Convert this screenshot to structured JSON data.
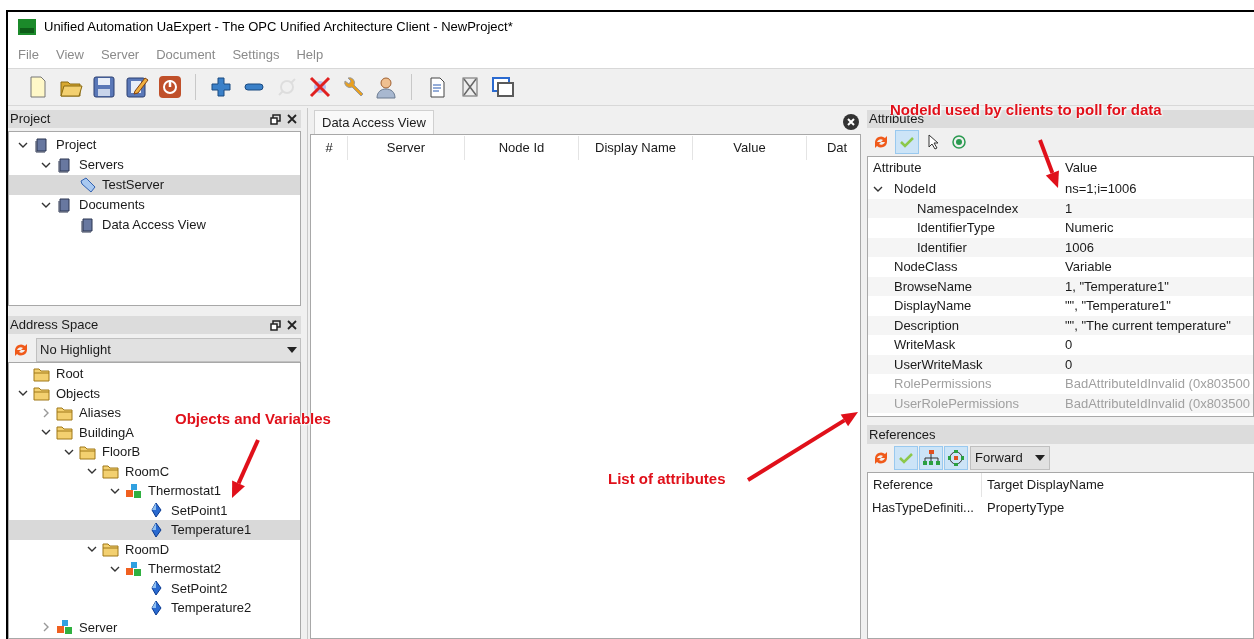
{
  "window": {
    "title": "Unified Automation UaExpert - The OPC Unified Architecture Client - NewProject*"
  },
  "menu": [
    "File",
    "View",
    "Server",
    "Document",
    "Settings",
    "Help"
  ],
  "toolbar": [
    {
      "disabled": false
    },
    {
      "disabled": false
    },
    {
      "disabled": false
    },
    {
      "disabled": false
    },
    {
      "disabled": false
    },
    {
      "disabled": false
    },
    {
      "disabled": false
    },
    {
      "disabled": true
    },
    {
      "disabled": false
    },
    {
      "disabled": false
    },
    {
      "disabled": false
    },
    {
      "disabled": false
    },
    {
      "disabled": false
    },
    {
      "disabled": false
    }
  ],
  "project_panel": {
    "title": "Project",
    "tree": [
      {
        "label": "Project",
        "kind": "book",
        "expanded": true,
        "selected": false,
        "children": [
          {
            "label": "Servers",
            "kind": "book",
            "expanded": true,
            "selected": false,
            "children": [
              {
                "label": "TestServer",
                "kind": "server",
                "selected": true
              }
            ]
          },
          {
            "label": "Documents",
            "kind": "book",
            "expanded": true,
            "selected": false,
            "children": [
              {
                "label": "Data Access View",
                "kind": "book",
                "selected": false
              }
            ]
          }
        ]
      }
    ]
  },
  "address_space_panel": {
    "title": "Address Space",
    "highlight": "No Highlight",
    "tree": [
      {
        "label": "Root",
        "kind": "folder",
        "selected": false
      },
      {
        "label": "Objects",
        "kind": "folder",
        "expanded": true,
        "selected": false,
        "children": [
          {
            "label": "Aliases",
            "kind": "folder",
            "expanded": false,
            "selected": false
          },
          {
            "label": "BuildingA",
            "kind": "folder",
            "expanded": true,
            "selected": false,
            "children": [
              {
                "label": "FloorB",
                "kind": "folder",
                "expanded": true,
                "selected": false,
                "children": [
                  {
                    "label": "RoomC",
                    "kind": "folder",
                    "expanded": true,
                    "selected": false,
                    "children": [
                      {
                        "label": "Thermostat1",
                        "kind": "object",
                        "expanded": true,
                        "selected": false,
                        "children": [
                          {
                            "label": "SetPoint1",
                            "kind": "variable",
                            "selected": false
                          },
                          {
                            "label": "Temperature1",
                            "kind": "variable",
                            "selected": true
                          }
                        ]
                      }
                    ]
                  },
                  {
                    "label": "RoomD",
                    "kind": "folder",
                    "expanded": true,
                    "selected": false,
                    "children": [
                      {
                        "label": "Thermostat2",
                        "kind": "object",
                        "expanded": true,
                        "selected": false,
                        "children": [
                          {
                            "label": "SetPoint2",
                            "kind": "variable",
                            "selected": false
                          },
                          {
                            "label": "Temperature2",
                            "kind": "variable",
                            "selected": false
                          }
                        ]
                      }
                    ]
                  }
                ]
              }
            ]
          },
          {
            "label": "Server",
            "kind": "object",
            "expanded": false,
            "selected": false
          }
        ]
      }
    ]
  },
  "document": {
    "tab": "Data Access View",
    "columns": [
      "#",
      "Server",
      "Node Id",
      "Display Name",
      "Value",
      "Dat"
    ]
  },
  "attributes_panel": {
    "title": "Attributes",
    "toolbar": [
      {
        "on": false
      },
      {
        "on": true
      },
      {
        "on": false
      },
      {
        "on": false
      }
    ],
    "columns": [
      "Attribute",
      "Value"
    ],
    "rows": [
      {
        "attribute": "NodeId",
        "value": "ns=1;i=1006",
        "disabled": false,
        "expanded": true,
        "children": [
          {
            "attribute": "NamespaceIndex",
            "value": "1",
            "disabled": false
          },
          {
            "attribute": "IdentifierType",
            "value": "Numeric",
            "disabled": false
          },
          {
            "attribute": "Identifier",
            "value": "1006",
            "disabled": false
          }
        ]
      },
      {
        "attribute": "NodeClass",
        "value": "Variable",
        "disabled": false
      },
      {
        "attribute": "BrowseName",
        "value": "1, \"Temperature1\"",
        "disabled": false
      },
      {
        "attribute": "DisplayName",
        "value": "\"\", \"Temperature1\"",
        "disabled": false
      },
      {
        "attribute": "Description",
        "value": "\"\", \"The current temperature\"",
        "disabled": false
      },
      {
        "attribute": "WriteMask",
        "value": "0",
        "disabled": false
      },
      {
        "attribute": "UserWriteMask",
        "value": "0",
        "disabled": false
      },
      {
        "attribute": "RolePermissions",
        "value": "BadAttributeIdInvalid (0x803500",
        "disabled": true
      },
      {
        "attribute": "UserRolePermissions",
        "value": "BadAttributeIdInvalid (0x803500",
        "disabled": true
      }
    ]
  },
  "references_panel": {
    "title": "References",
    "toolbar": [
      {
        "on": false
      },
      {
        "on": true
      },
      {
        "on": true
      },
      {
        "on": true
      }
    ],
    "direction": "Forward",
    "columns": [
      "Reference",
      "Target DisplayName"
    ],
    "rows": [
      {
        "reference": "HasTypeDefiniti...",
        "target": "PropertyType"
      }
    ]
  },
  "annotations": [
    {
      "text": "NodeId used by clients to poll for data"
    },
    {
      "text": "Objects and Variables"
    },
    {
      "text": "List of attributes"
    }
  ]
}
